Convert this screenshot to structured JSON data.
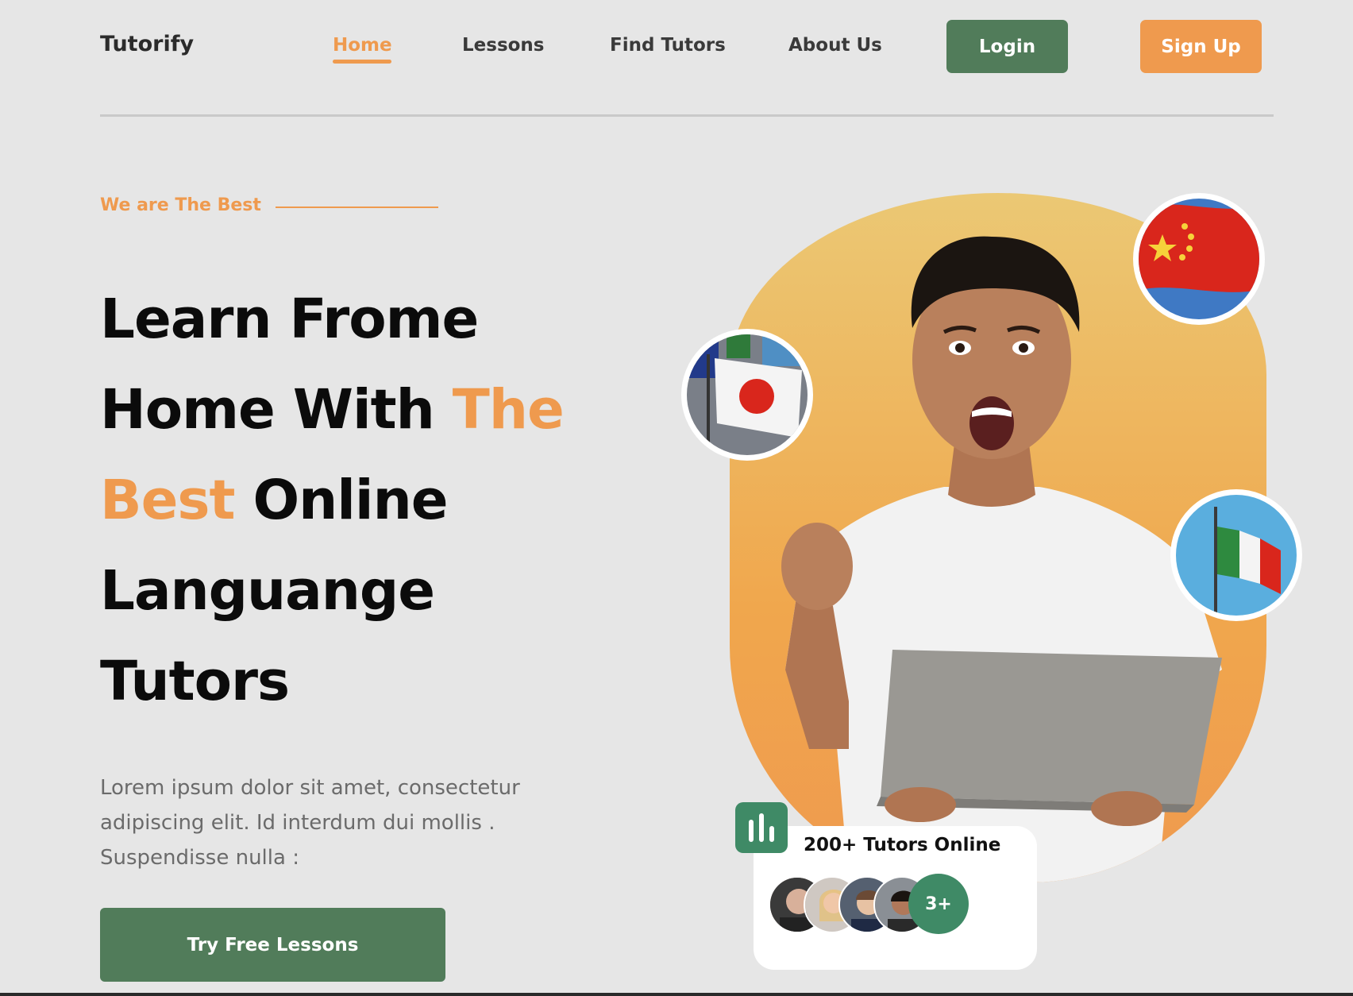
{
  "header": {
    "brand": "Tutorify",
    "nav": [
      "Home",
      "Lessons",
      "Find Tutors",
      "About Us"
    ],
    "active_nav": "Home",
    "login_label": "Login",
    "signup_label": "Sign Up"
  },
  "hero": {
    "tagline": "We are The Best",
    "headline": {
      "part1": "Learn Frome",
      "part2": "Home With",
      "highlight1": "The",
      "highlight2": "Best",
      "part3": "Online",
      "part4": "Languange",
      "part5": "Tutors"
    },
    "description": "Lorem ipsum dolor sit amet, consectetur adipiscing elit. Id interdum dui mollis . Suspendisse nulla :",
    "cta_label": "Try Free Lessons"
  },
  "stats": {
    "label": "200+ Tutors Online",
    "more_badge": "3+"
  },
  "flags": [
    "japan-flag",
    "china-flag",
    "italy-flag"
  ],
  "colors": {
    "accent": "#ef9a4e",
    "primary": "#517c5a",
    "stat_green": "#3f8a66",
    "background": "#e6e6e6"
  }
}
